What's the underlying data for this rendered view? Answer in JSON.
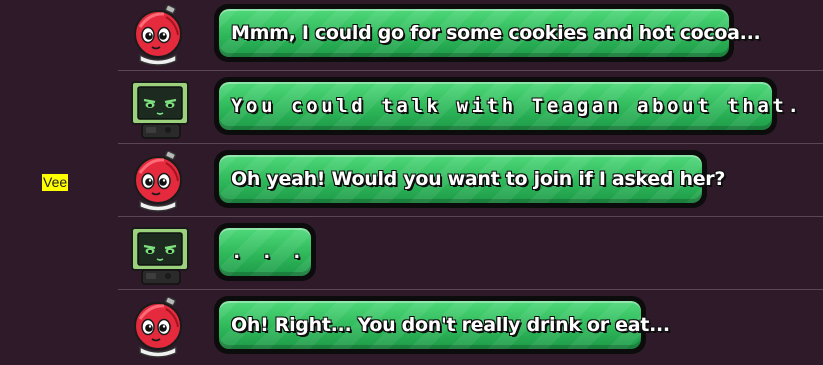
{
  "speaker_tag": "Vee",
  "colors": {
    "background": "#2e1a28",
    "bubble_green": "#2eb85a",
    "bubble_border": "#0c0c0c",
    "speaker_tag_bg": "#ffff00"
  },
  "messages": [
    {
      "speaker": "red-character",
      "text": "Mmm, I could go for some cookies and hot cocoa..."
    },
    {
      "speaker": "monitor-character",
      "text": "You could talk with Teagan about that."
    },
    {
      "speaker": "red-character",
      "text": "Oh yeah! Would you want to join if I asked her?"
    },
    {
      "speaker": "monitor-character",
      "text": ". . ."
    },
    {
      "speaker": "red-character",
      "text": "Oh! Right... You don't really drink or eat..."
    }
  ]
}
